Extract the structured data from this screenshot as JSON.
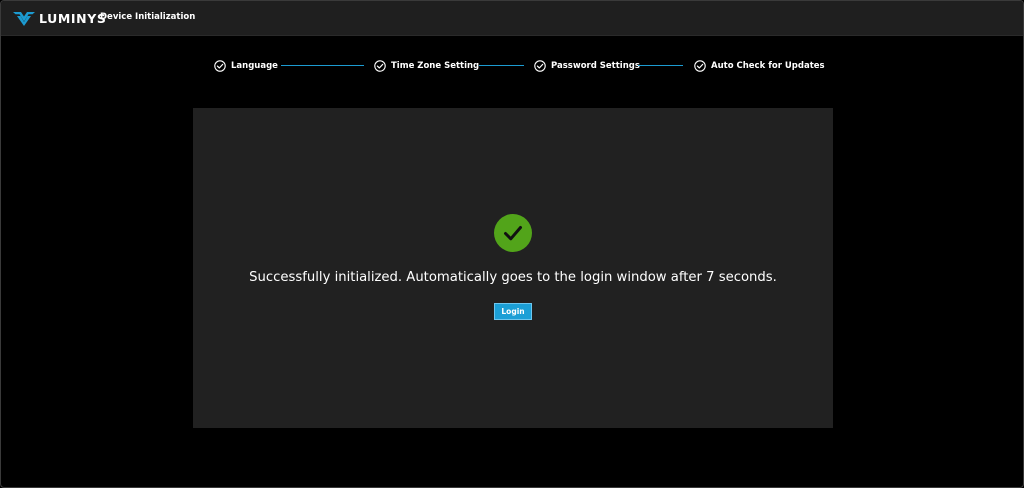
{
  "header": {
    "brand": "LUMINYS",
    "title": "Device Initialization",
    "logo_icon": "luminys-logo-icon",
    "brand_color": "#1c9bd1"
  },
  "steps": [
    {
      "label": "Language",
      "status": "complete",
      "icon": "check-circle-icon"
    },
    {
      "label": "Time Zone Setting",
      "status": "complete",
      "icon": "check-circle-icon"
    },
    {
      "label": "Password Settings",
      "status": "complete",
      "icon": "check-circle-icon"
    },
    {
      "label": "Auto Check for Updates",
      "status": "complete",
      "icon": "check-circle-icon"
    }
  ],
  "connector_color": "#1c9bd1",
  "result": {
    "icon": "success-check-icon",
    "icon_color": "#52a41a",
    "message": "Successfully initialized. Automatically goes to the login window after 7 seconds.",
    "login_label": "Login",
    "button_color": "#1b9fd6"
  }
}
